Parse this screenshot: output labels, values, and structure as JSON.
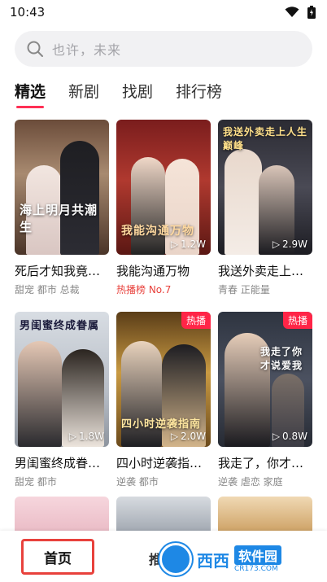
{
  "status_bar": {
    "time": "10:43"
  },
  "search": {
    "placeholder": "也许，未来"
  },
  "tabs": [
    {
      "label": "精选",
      "active": true
    },
    {
      "label": "新剧",
      "active": false
    },
    {
      "label": "找剧",
      "active": false
    },
    {
      "label": "排行榜",
      "active": false
    }
  ],
  "dramas": [
    {
      "title": "死后才知我竟…",
      "tags": "甜宠 都市 总裁",
      "views": "",
      "badge": "",
      "poster_text": "海上明月共潮生"
    },
    {
      "title": "我能沟通万物",
      "tags": "热播榜 No.7",
      "views": "1.2W",
      "badge": "",
      "poster_text": "我能沟通万物"
    },
    {
      "title": "我送外卖走上…",
      "tags": "青春 正能量",
      "views": "2.9W",
      "badge": "",
      "poster_text": "我送外卖走上人生巅峰"
    },
    {
      "title": "男闺蜜终成眷…",
      "tags": "甜宠 都市",
      "views": "1.8W",
      "badge": "",
      "poster_text": "男闺蜜终成眷属"
    },
    {
      "title": "四小时逆袭指…",
      "tags": "逆袭 都市",
      "views": "2.0W",
      "badge": "热播",
      "poster_text": "四小时逆袭指南"
    },
    {
      "title": "我走了，你才…",
      "tags": "逆袭 虐恋 家庭",
      "views": "0.8W",
      "badge": "热播",
      "poster_text": "我走了你才说爱我"
    }
  ],
  "bottom_nav": {
    "home": "首页",
    "recommend": "推荐"
  },
  "watermark": {
    "text": "西西",
    "cn": "软件园",
    "url": "CR173.COM"
  },
  "colors": {
    "accent": "#ff2f55",
    "hot": "#e8413c",
    "badge": "#ff2547"
  }
}
